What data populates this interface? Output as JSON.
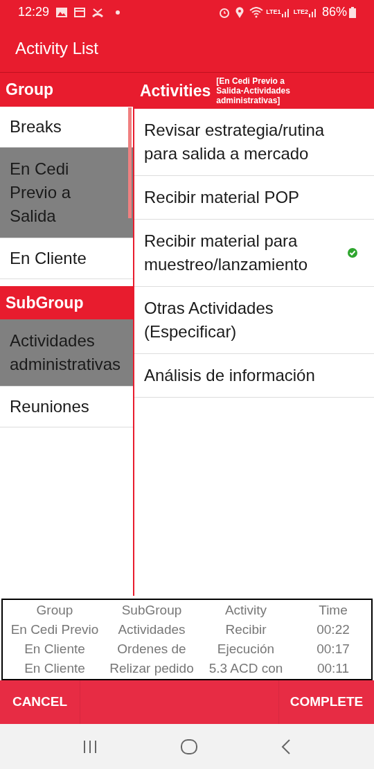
{
  "status_bar": {
    "time": "12:29",
    "sim1": "LTE1",
    "sim2": "LTE2",
    "battery": "86%"
  },
  "app_bar": {
    "title": "Activity List"
  },
  "group": {
    "header": "Group",
    "items": [
      {
        "label": "Breaks",
        "selected": false
      },
      {
        "label": "En Cedi Previo a Salida",
        "selected": true
      },
      {
        "label": "En Cliente",
        "selected": false
      }
    ]
  },
  "subgroup": {
    "header": "SubGroup",
    "items": [
      {
        "label": "Actividades administrativas",
        "selected": true
      },
      {
        "label": "Reuniones",
        "selected": false
      }
    ]
  },
  "activities": {
    "header": "Activities",
    "context": "[En Cedi Previo a Salida-Actividades administrativas]",
    "items": [
      {
        "label": "Revisar estrategia/rutina para salida a mercado",
        "checked": false
      },
      {
        "label": "Recibir material POP",
        "checked": false
      },
      {
        "label": "Recibir material para muestreo/lanzamiento",
        "checked": true
      },
      {
        "label": "Otras Actividades (Especificar)",
        "checked": false
      },
      {
        "label": "Análisis de información",
        "checked": false
      }
    ]
  },
  "summary_table": {
    "columns": [
      "Group",
      "SubGroup",
      "Activity",
      "Time"
    ],
    "rows": [
      [
        "En Cedi Previo",
        "Actividades",
        "Recibir",
        "00:22"
      ],
      [
        "En Cliente",
        "Ordenes de",
        "Ejecución",
        "00:17"
      ],
      [
        "En Cliente",
        "Relizar pedido",
        "5.3 ACD con",
        "00:11"
      ]
    ]
  },
  "buttons": {
    "cancel": "CANCEL",
    "complete": "COMPLETE"
  }
}
